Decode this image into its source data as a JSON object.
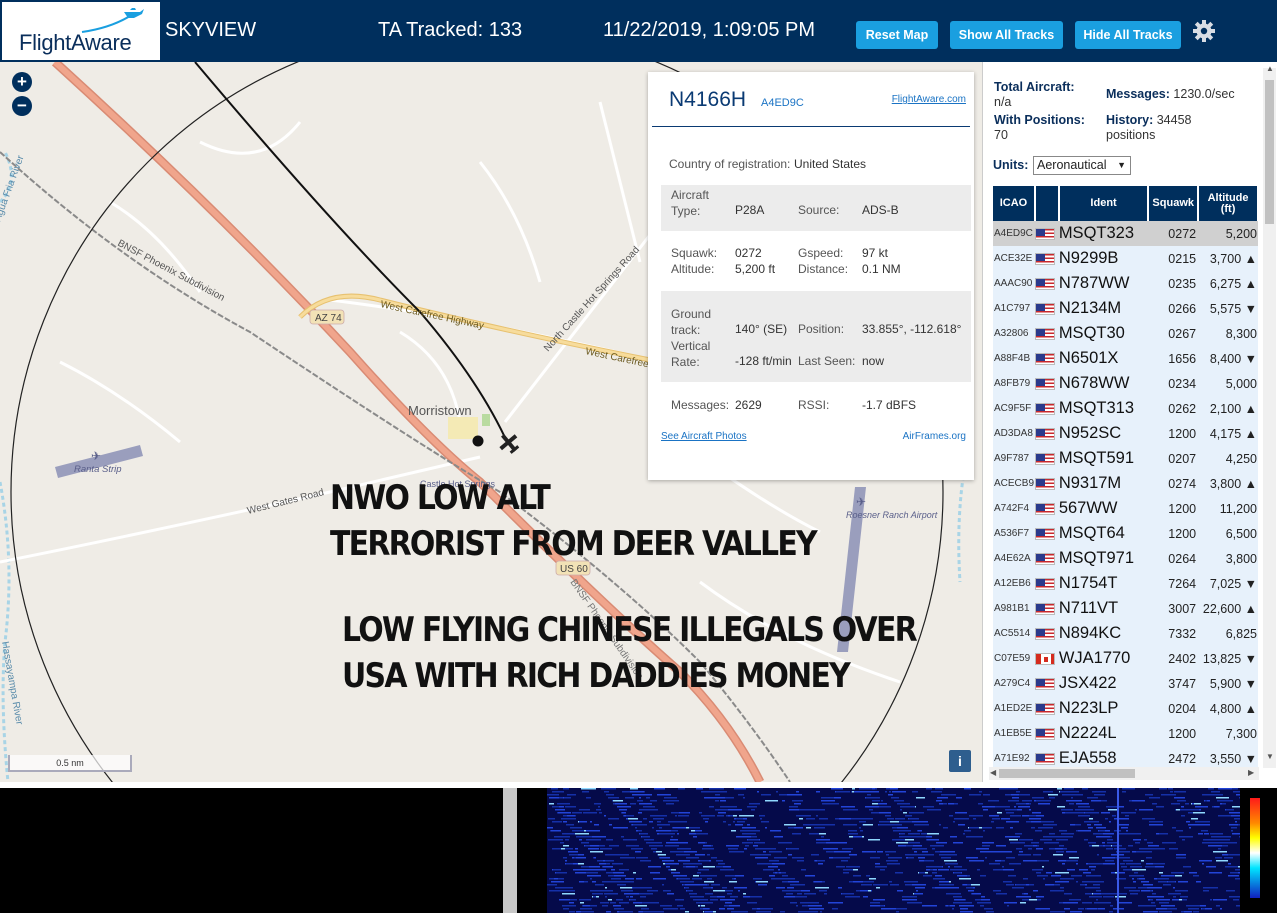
{
  "header": {
    "logo": "FlightAware",
    "app_name": "SKYVIEW",
    "tracked": "TA Tracked: 133",
    "datetime": "11/22/2019, 1:09:05 PM",
    "buttons": {
      "reset": "Reset Map",
      "show_all": "Show All Tracks",
      "hide_all": "Hide All Tracks"
    },
    "settings_icon": "gear-icon"
  },
  "map": {
    "zoom_in": "+",
    "zoom_out": "−",
    "scale": "0.5 nm",
    "info": "i",
    "labels": {
      "morristown": "Morristown",
      "az74": "AZ 74",
      "us60": "US 60",
      "west_carefree": "West Carefree Highway",
      "west_carefree2": "West Carefree",
      "north_castle": "North Castle Hot Springs Road",
      "bnsf": "BNSF Phoenix Subdivision",
      "west_gates": "West Gates Road",
      "ranta": "Ranta Strip",
      "roesner": "Roesner Ranch Airport",
      "hassayampa": "Hassayampa River",
      "agua": "Agua Fria River",
      "castle_hot": "Castle Hot Springs"
    },
    "overlay": [
      "NWO LOW ALT",
      "TERRORIST FROM DEER VALLEY",
      "LOW FLYING CHINESE ILLEGALS OVER",
      "USA WITH RICH DADDIES MONEY"
    ]
  },
  "selected": {
    "registration": "N4166H",
    "hex": "A4ED9C",
    "fa_link": "FlightAware.com",
    "country_label": "Country of registration:",
    "country": "United States",
    "aircraft_type_label": "Aircraft Type:",
    "aircraft_type": "P28A",
    "source_label": "Source:",
    "source": "ADS-B",
    "squawk_label": "Squawk:",
    "squawk": "0272",
    "gspeed_label": "Gspeed:",
    "gspeed": "97 kt",
    "altitude_label": "Altitude:",
    "altitude": "5,200 ft",
    "distance_label": "Distance:",
    "distance": "0.1 NM",
    "track_label": "Ground track:",
    "track": "140° (SE)",
    "position_label": "Position:",
    "position": "33.855°, -112.618°",
    "vrate_label": "Vertical Rate:",
    "vrate": "-128 ft/min",
    "lastseen_label": "Last Seen:",
    "lastseen": "now",
    "messages_label": "Messages:",
    "messages": "2629",
    "rssi_label": "RSSI:",
    "rssi": "-1.7 dBFS",
    "photos_link": "See Aircraft Photos",
    "airframes_link": "AirFrames.org"
  },
  "sidebar": {
    "total_label": "Total Aircraft:",
    "total": "n/a",
    "messages_label": "Messages:",
    "messages": "1230.0/sec",
    "positions_label": "With Positions:",
    "positions": "70",
    "history_label": "History:",
    "history": "34458 positions",
    "units_label": "Units:",
    "units": "Aeronautical",
    "columns": [
      "ICAO",
      "",
      "Ident",
      "Squawk",
      "Altitude (ft)"
    ],
    "rows": [
      {
        "icao": "A4ED9C",
        "flag": "us",
        "ident": "MSQT323",
        "squawk": "0272",
        "alt": "5,200",
        "sel": true
      },
      {
        "icao": "ACE32E",
        "flag": "us",
        "ident": "N9299B",
        "squawk": "0215",
        "alt": "3,700 ▲"
      },
      {
        "icao": "AAAC90",
        "flag": "us",
        "ident": "N787WW",
        "squawk": "0235",
        "alt": "6,275 ▲"
      },
      {
        "icao": "A1C797",
        "flag": "us",
        "ident": "N2134M",
        "squawk": "0266",
        "alt": "5,575 ▼"
      },
      {
        "icao": "A32806",
        "flag": "us",
        "ident": "MSQT30",
        "squawk": "0267",
        "alt": "8,300"
      },
      {
        "icao": "A88F4B",
        "flag": "us",
        "ident": "N6501X",
        "squawk": "1656",
        "alt": "8,400 ▼"
      },
      {
        "icao": "A8FB79",
        "flag": "us",
        "ident": "N678WW",
        "squawk": "0234",
        "alt": "5,000"
      },
      {
        "icao": "AC9F5F",
        "flag": "us",
        "ident": "MSQT313",
        "squawk": "0262",
        "alt": "2,100 ▲"
      },
      {
        "icao": "AD3DA8",
        "flag": "us",
        "ident": "N952SC",
        "squawk": "1200",
        "alt": "4,175 ▲"
      },
      {
        "icao": "A9F787",
        "flag": "us",
        "ident": "MSQT591",
        "squawk": "0207",
        "alt": "4,250"
      },
      {
        "icao": "ACECB9",
        "flag": "us",
        "ident": "N9317M",
        "squawk": "0274",
        "alt": "3,800 ▲"
      },
      {
        "icao": "A742F4",
        "flag": "us",
        "ident": "567WW",
        "squawk": "1200",
        "alt": "11,200"
      },
      {
        "icao": "A536F7",
        "flag": "us",
        "ident": "MSQT64",
        "squawk": "1200",
        "alt": "6,500"
      },
      {
        "icao": "A4E62A",
        "flag": "us",
        "ident": "MSQT971",
        "squawk": "0264",
        "alt": "3,800"
      },
      {
        "icao": "A12EB6",
        "flag": "us",
        "ident": "N1754T",
        "squawk": "7264",
        "alt": "7,025 ▼"
      },
      {
        "icao": "A981B1",
        "flag": "us",
        "ident": "N711VT",
        "squawk": "3007",
        "alt": "22,600 ▲"
      },
      {
        "icao": "AC5514",
        "flag": "us",
        "ident": "N894KC",
        "squawk": "7332",
        "alt": "6,825"
      },
      {
        "icao": "C07E59",
        "flag": "ca",
        "ident": "WJA1770",
        "squawk": "2402",
        "alt": "13,825 ▼"
      },
      {
        "icao": "A279C4",
        "flag": "us",
        "ident": "JSX422",
        "squawk": "3747",
        "alt": "5,900 ▼"
      },
      {
        "icao": "A1ED2E",
        "flag": "us",
        "ident": "N223LP",
        "squawk": "0204",
        "alt": "4,800 ▲"
      },
      {
        "icao": "A1EB5E",
        "flag": "us",
        "ident": "N2224L",
        "squawk": "1200",
        "alt": "7,300"
      },
      {
        "icao": "A71E92",
        "flag": "us",
        "ident": "EJA558",
        "squawk": "2472",
        "alt": "3,550 ▼"
      }
    ]
  },
  "colors": {
    "header_bg": "#002f5d",
    "button_bg": "#1a9fe0",
    "highway": "#e8a08a",
    "map_bg": "#efece6"
  }
}
